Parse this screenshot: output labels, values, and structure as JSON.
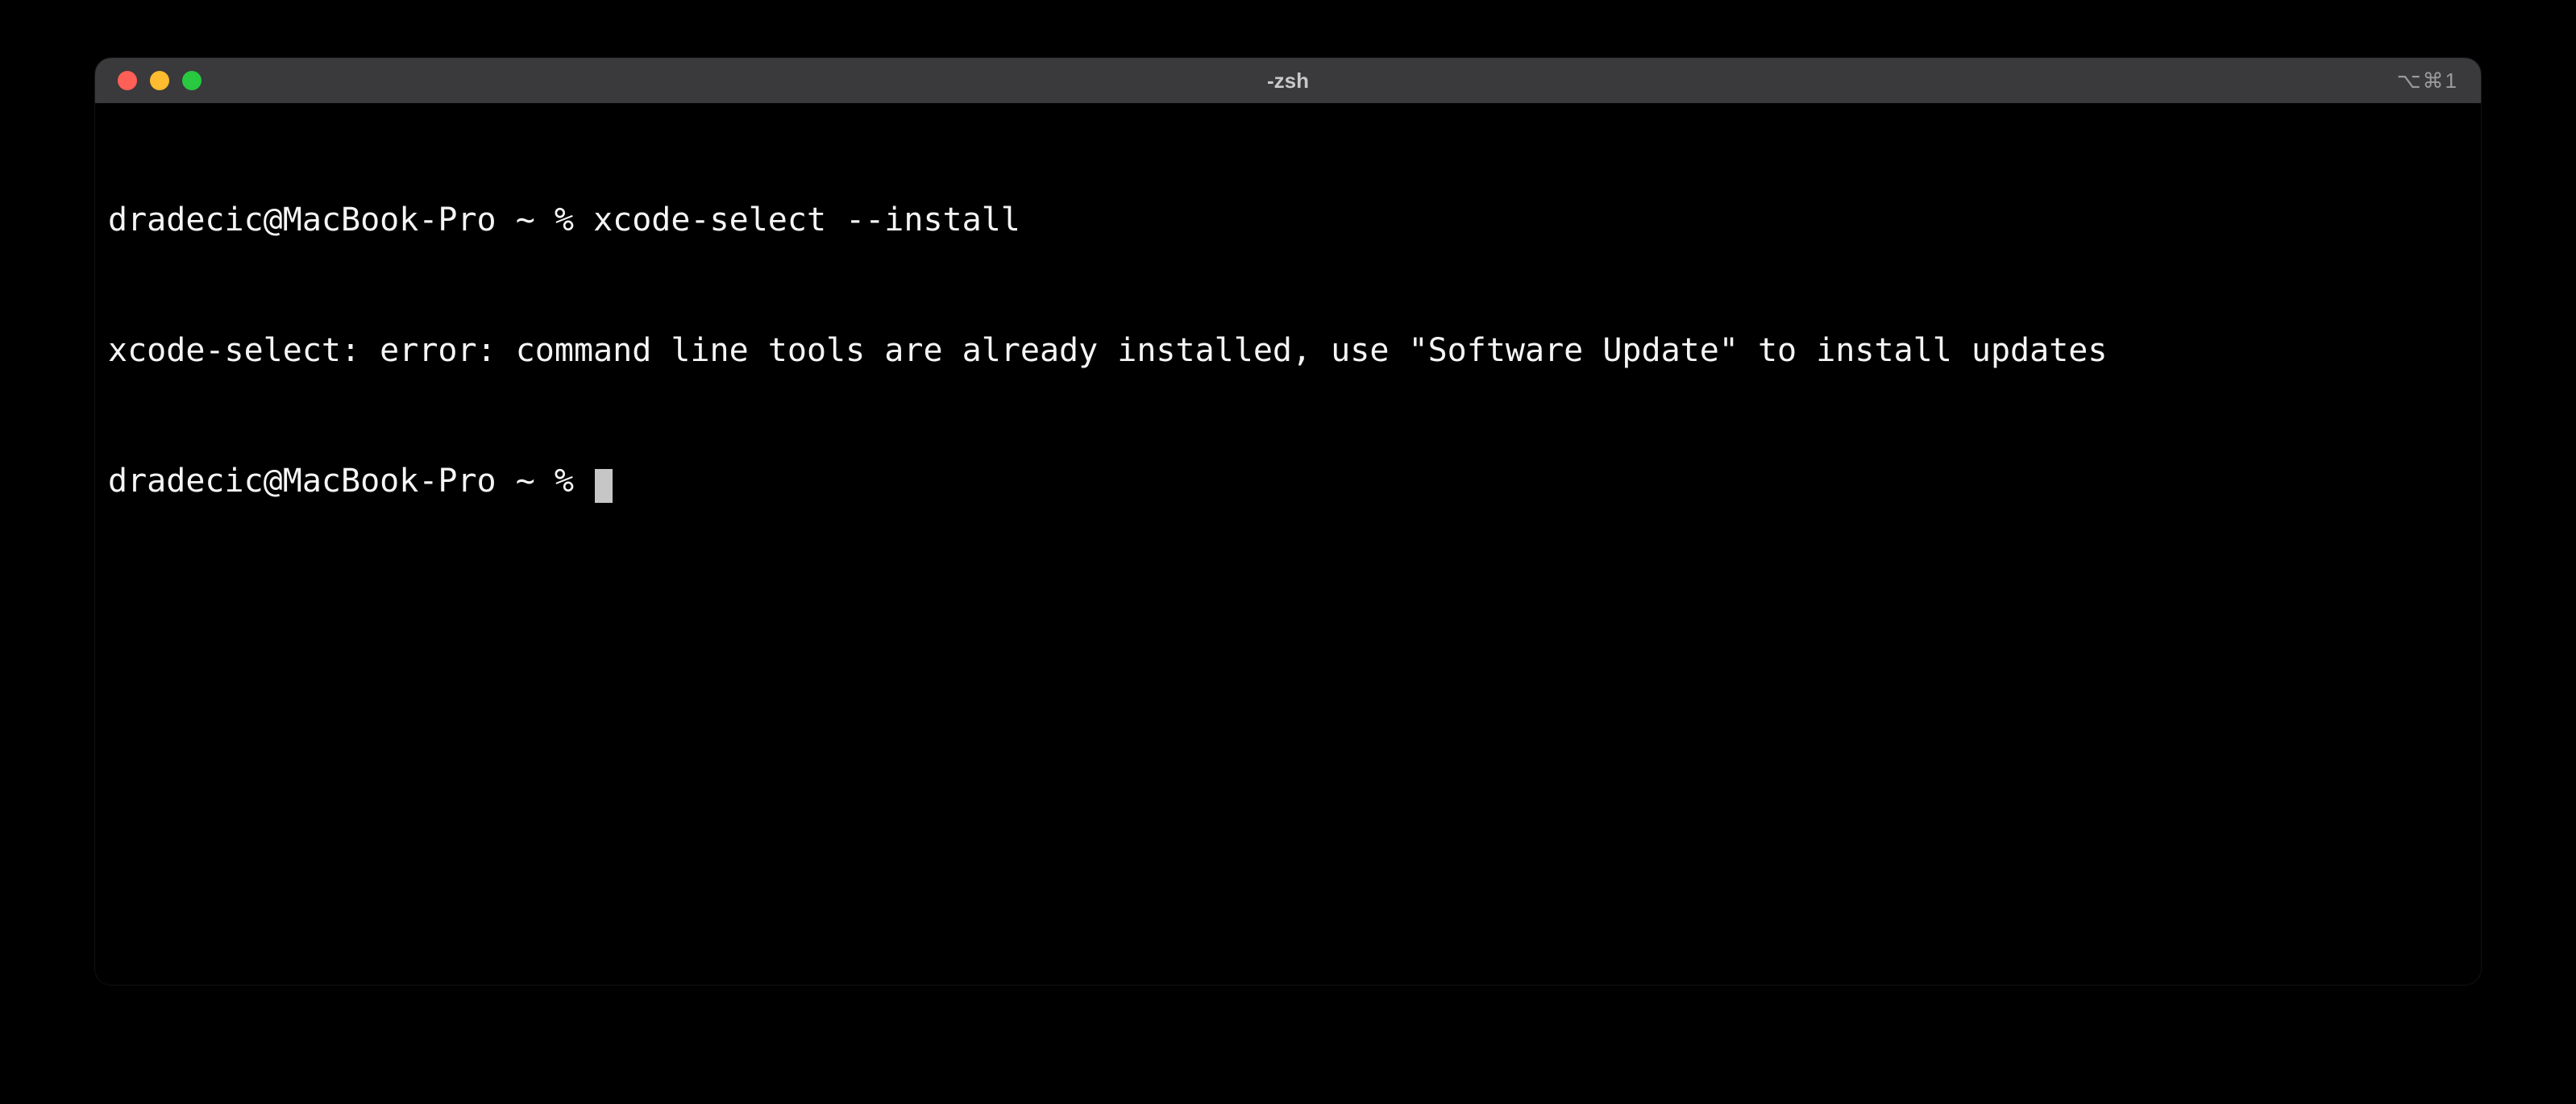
{
  "window": {
    "title": "-zsh",
    "tab_indicator": "⌥⌘1"
  },
  "terminal": {
    "lines": [
      {
        "prompt": "dradecic@MacBook-Pro ~ % ",
        "command": "xcode-select --install"
      },
      {
        "output": "xcode-select: error: command line tools are already installed, use \"Software Update\" to install updates"
      },
      {
        "prompt": "dradecic@MacBook-Pro ~ % ",
        "cursor": true
      }
    ]
  }
}
